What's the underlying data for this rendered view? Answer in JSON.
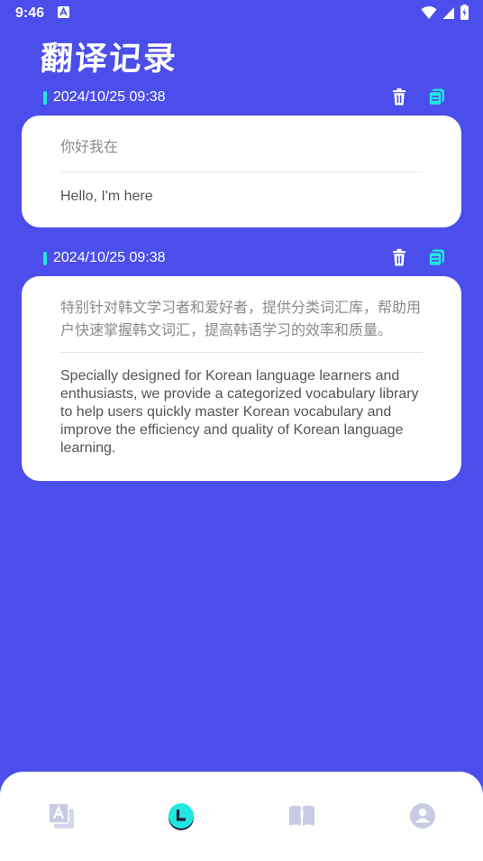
{
  "status_bar": {
    "time": "9:46"
  },
  "page": {
    "title": "翻译记录"
  },
  "records": [
    {
      "date": "2024/10/25 09:38",
      "source": "你好我在",
      "translation": "Hello, I'm here"
    },
    {
      "date": "2024/10/25 09:38",
      "source": "特别针对韩文学习者和爱好者，提供分类词汇库，帮助用户快速掌握韩文词汇，提高韩语学习的效率和质量。",
      "translation": "Specially designed for Korean language learners and enthusiasts, we provide a categorized vocabulary library to help users quickly master Korean vocabulary and improve the efficiency and quality of Korean language learning."
    }
  ],
  "colors": {
    "background": "#4b4eea",
    "accent": "#22e6e0",
    "card": "#ffffff",
    "nav_inactive": "#c9cbe4"
  },
  "nav": {
    "items": [
      {
        "icon": "translate-icon",
        "active": false
      },
      {
        "icon": "history-clock-icon",
        "active": true
      },
      {
        "icon": "book-icon",
        "active": false
      },
      {
        "icon": "profile-icon",
        "active": false
      }
    ]
  }
}
